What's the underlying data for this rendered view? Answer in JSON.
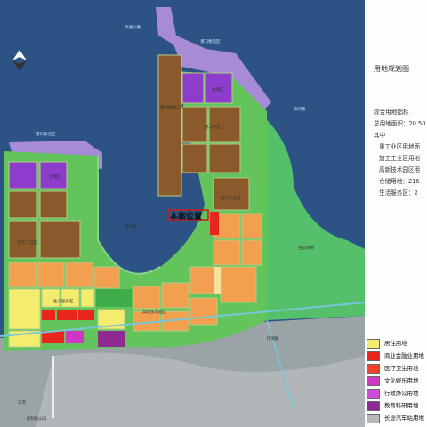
{
  "side": {
    "title": "用地规划图",
    "section_title": "综合用地指标",
    "total_area": "总用地面积：20.50",
    "among": "其中",
    "zones": [
      "重工业区用地面",
      "加工工业区用地",
      "高新技术园区用",
      "仓储用地：216",
      "生活服务区：2"
    ]
  },
  "legend": [
    {
      "label": "居住用地",
      "color": "#f4ec6e"
    },
    {
      "label": "商业金融业用地",
      "color": "#e8261c"
    },
    {
      "label": "医疗卫生用地",
      "color": "#f2422a"
    },
    {
      "label": "文化娱乐用地",
      "color": "#cf37c4"
    },
    {
      "label": "行政办公用地",
      "color": "#d04bd9"
    },
    {
      "label": "教育科研用地",
      "color": "#8e2a91"
    },
    {
      "label": "长途汽车站用地",
      "color": "#b8b8b8"
    }
  ],
  "map": {
    "project_site": "本案位置",
    "labels": {
      "lake": "金湾湖",
      "heavy_industry": "重工业区",
      "heavy_industry_small": "重机械加工区",
      "processing_industry": "加工工业区",
      "processing_industry_east": "加工工业区",
      "hitech_park": "高新技术园区",
      "living_service": "生活服务区",
      "warehouse_west": "仓储区",
      "warehouse_east": "仓储区",
      "port_north": "港口物流区",
      "port_west": "港口物流区",
      "road_east": "滨河路",
      "road_south": "环湖路",
      "village": "东岸",
      "area_east": "生态绿地",
      "expressway": "高速公路",
      "rail_line": "往阿拉山口"
    }
  }
}
